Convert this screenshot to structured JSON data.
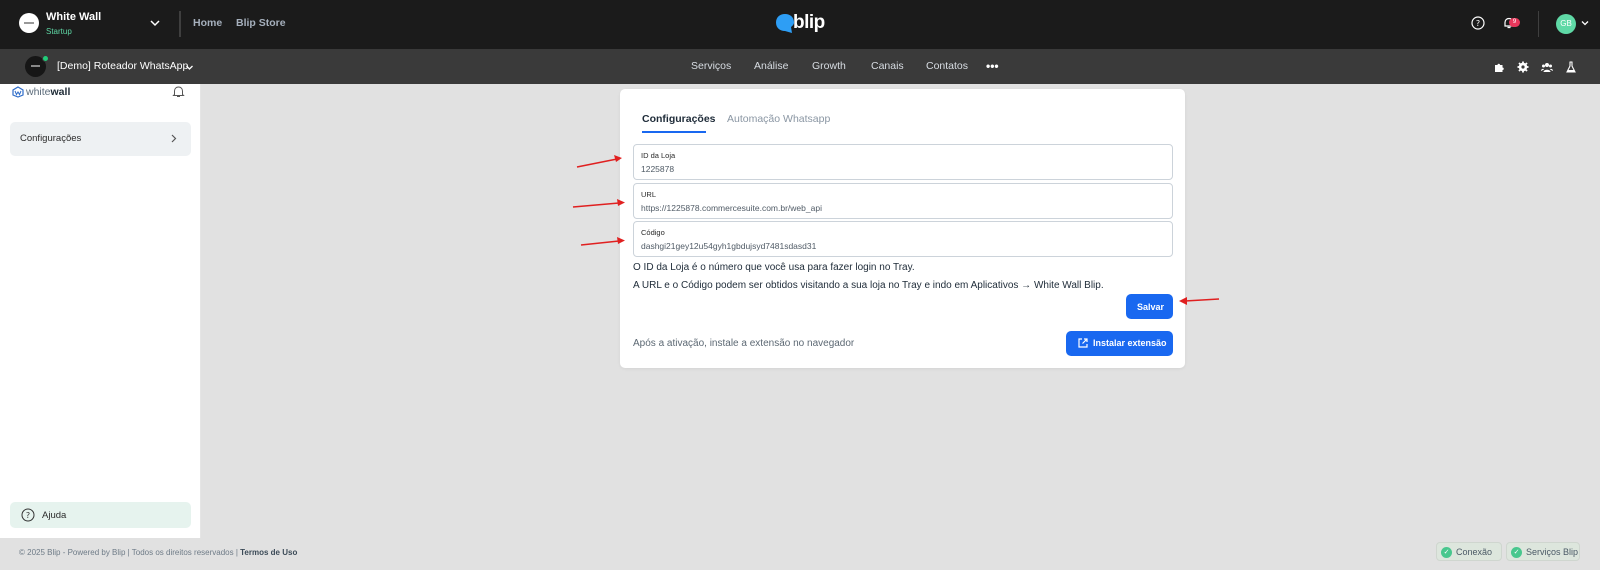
{
  "topbar": {
    "org_name": "White Wall",
    "org_plan": "Startup",
    "links": [
      "Home",
      "Blip Store"
    ],
    "brand": "blip",
    "notification_count": "9",
    "avatar_initials": "GB"
  },
  "subnav": {
    "bot_name": "[Demo] Roteador WhatsApp",
    "items": [
      "Serviços",
      "Análise",
      "Growth",
      "Canais",
      "Contatos"
    ],
    "more": "•••",
    "icons": [
      "puzzle-icon",
      "gear-icon",
      "team-icon",
      "flask-icon"
    ]
  },
  "sidebar": {
    "logo_light": "white",
    "logo_bold": "wall",
    "items": [
      {
        "label": "Configurações"
      }
    ],
    "help_label": "Ajuda"
  },
  "footer": {
    "copyright": "© 2025 Blip - Powered by Blip | Todos os direitos reservados |",
    "terms": "Termos de Uso",
    "status": [
      "Conexão",
      "Serviços Blip"
    ]
  },
  "card": {
    "tabs": [
      {
        "label": "Configurações",
        "active": true
      },
      {
        "label": "Automação Whatsapp",
        "active": false
      }
    ],
    "fields": [
      {
        "label": "ID da Loja",
        "value": "1225878"
      },
      {
        "label": "URL",
        "value": "https://1225878.commercesuite.com.br/web_api"
      },
      {
        "label": "Código",
        "value": "dashgi21gey12u54gyh1gbdujsyd7481sdasd31"
      }
    ],
    "help_line_1": "O ID da Loja é o número que você usa para fazer login no Tray.",
    "help_line_2": "A URL e o Código podem ser obtidos visitando a sua loja no Tray e indo em Aplicativos → White Wall Blip.",
    "save_label": "Salvar",
    "after_activation": "Após a ativação, instale a extensão no navegador",
    "install_label": "Instalar extensão"
  },
  "colors": {
    "accent": "#1968f0",
    "topbar_bg": "#1b1b1b",
    "subnav_bg": "#3a3a3a",
    "page_bg": "#e1e1e1",
    "annotation_arrow": "#e02020",
    "online": "#21cc79"
  }
}
